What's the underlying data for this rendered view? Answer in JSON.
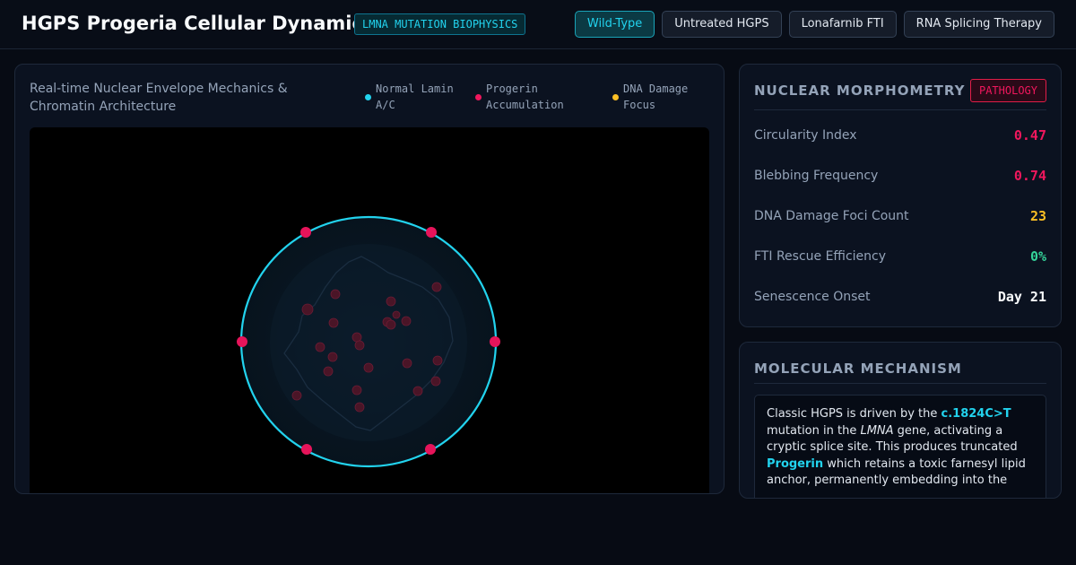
{
  "header": {
    "title": "HGPS Progeria Cellular Dynamics",
    "badge": "LMNA MUTATION BIOPHYSICS",
    "tabs": [
      {
        "label": "Wild-Type",
        "active": true
      },
      {
        "label": "Untreated HGPS",
        "active": false
      },
      {
        "label": "Lonafarnib FTI",
        "active": false
      },
      {
        "label": "RNA Splicing Therapy",
        "active": false
      }
    ]
  },
  "visualization": {
    "title": "Real-time Nuclear Envelope Mechanics & Chromatin Architecture",
    "legend": [
      {
        "label": "Normal Lamin A/C",
        "color": "#22d3ee"
      },
      {
        "label": "Progerin Accumulation",
        "color": "#f0175d"
      },
      {
        "label": "DNA Damage Focus",
        "color": "#fbbf24"
      }
    ]
  },
  "morphometry": {
    "title": "NUCLEAR MORPHOMETRY",
    "status_badge": "PATHOLOGY",
    "metrics": [
      {
        "label": "Circularity Index",
        "value": "0.47",
        "color": "#f0175d"
      },
      {
        "label": "Blebbing Frequency",
        "value": "0.74",
        "color": "#f0175d"
      },
      {
        "label": "DNA Damage Foci Count",
        "value": "23",
        "color": "#fbbf24"
      },
      {
        "label": "FTI Rescue Efficiency",
        "value": "0%",
        "color": "#34d399"
      },
      {
        "label": "Senescence Onset",
        "value": "Day 21",
        "color": "#f8fafc"
      }
    ]
  },
  "mechanism": {
    "title": "MOLECULAR MECHANISM",
    "text": {
      "p1": "Classic HGPS is driven by the ",
      "mutation": "c.1824C>T",
      "p2": " mutation in the ",
      "gene": "LMNA",
      "p3": " gene, activating a cryptic splice site. This produces truncated ",
      "protein": "Progerin",
      "p4": " which retains a toxic farnesyl lipid anchor, permanently embedding into the"
    }
  }
}
